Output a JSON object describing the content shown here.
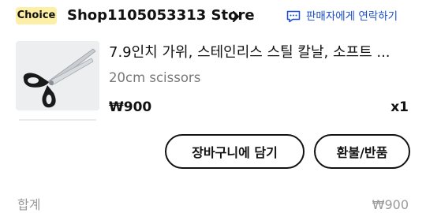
{
  "store": {
    "badge": "Choice",
    "name": "Shop1105053313 Store",
    "contact_label": "판매자에게 연락하기"
  },
  "item": {
    "title": "7.9인치 가위, 스테인리스 스틸 칼날, 소프트 ...",
    "variant": "20cm scissors",
    "price": "₩900",
    "quantity": "x1"
  },
  "actions": {
    "add_to_cart": "장바구니에 담기",
    "refund_return": "환불/반품"
  },
  "footer": {
    "total_label": "합계",
    "total_value": "₩900"
  },
  "colors": {
    "badge_bg": "#fdf0a6",
    "link": "#1a4fc9",
    "muted": "#777777"
  },
  "icons": {
    "store_chevron": "chevron-right-icon",
    "contact": "chat-bubble-icon"
  }
}
